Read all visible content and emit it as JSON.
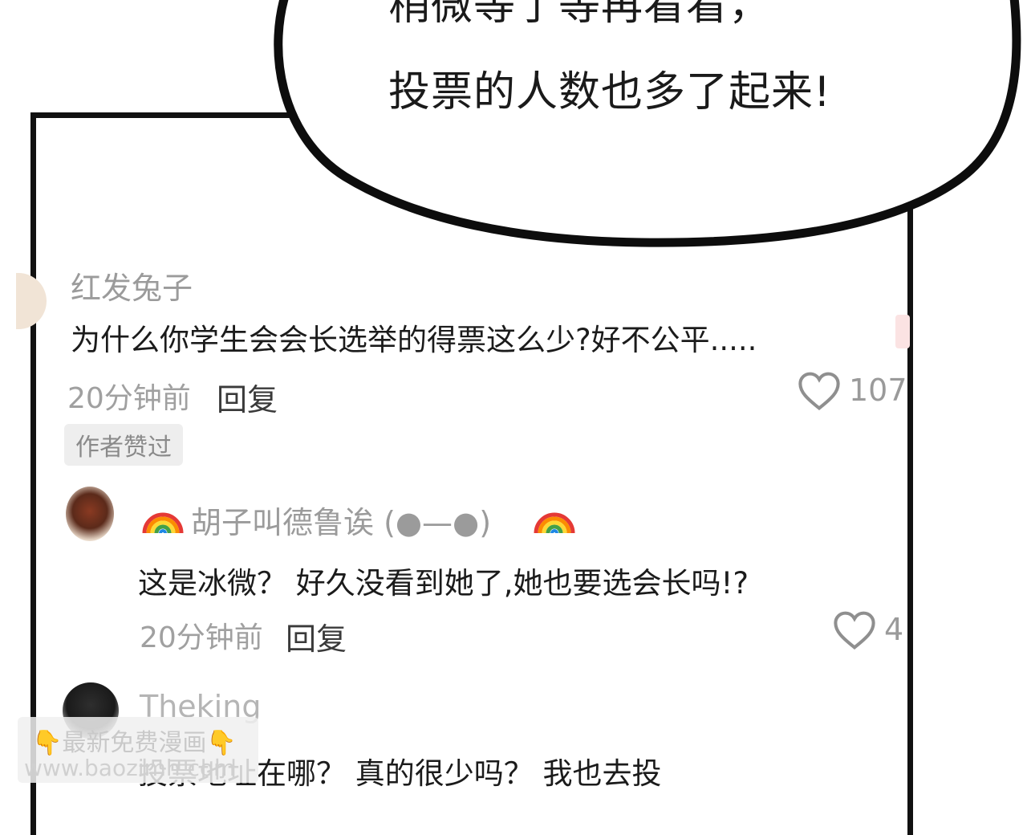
{
  "bubble": {
    "line1": "稍微等了等再看看，",
    "line2": "投票的人数也多了起来!"
  },
  "comments": [
    {
      "username": "红发兔子",
      "content": "为什么你学生会会长选举的得票这么少?好不公平.....",
      "time": "20分钟前",
      "reply_label": "回复",
      "likes": "107",
      "badge": "作者赞过"
    },
    {
      "username": "胡子叫德鲁诶 (●—●)",
      "content": "这是冰微？ 好久没看到她了,她也要选会长吗!?",
      "time": "20分钟前",
      "reply_label": "回复",
      "likes": "4"
    },
    {
      "username": "Theking",
      "content": "投票地址在哪？ 真的很少吗？ 我也去投"
    }
  ],
  "watermark": {
    "line1": "最新免费漫画",
    "line2": "www.baozimh.com"
  },
  "icons": {
    "like": "heart-outline-icon",
    "name_decoration": "rainbow-icon",
    "watermark": "pointing-down-icon"
  }
}
